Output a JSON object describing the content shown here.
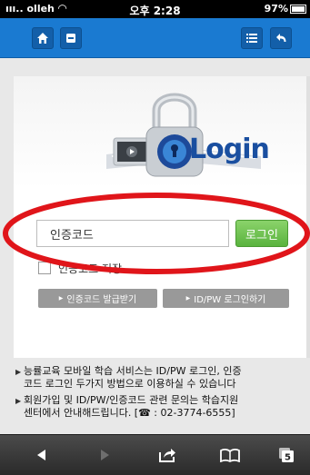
{
  "status": {
    "carrier": "olleh",
    "time": "오후 2:28",
    "battery": "97%"
  },
  "header": {
    "icons": [
      "home-icon",
      "bookmark-icon",
      "list-icon",
      "back-icon"
    ]
  },
  "login": {
    "title": "Login",
    "code_placeholder": "인증코드",
    "login_button": "로그인",
    "save_label": "인증코드 저장",
    "issue_button": "인증코드 발급받기",
    "idpw_button": "ID/PW 로그인하기"
  },
  "info": {
    "items": [
      [
        "능률교육 모바일 학습 서비스는 ID/PW 로그인, 인증",
        "코드 로그인 두가지 방법으로 이용하실 수 있습니다"
      ],
      [
        "회원가입 및 ID/PW/인증코드 관련 문의는 학습지원",
        "센터에서 안내해드립니다. [☎ : 02-3774-6555]"
      ]
    ]
  },
  "colors": {
    "header": "#1a7ad1",
    "login_button": "#59b33e",
    "annotation": "#e0151a"
  },
  "toolbar": {
    "icons": [
      "back-arrow-icon",
      "forward-arrow-icon",
      "share-icon",
      "bookmarks-icon",
      "tabs-icon"
    ],
    "tabs_count": "5"
  }
}
